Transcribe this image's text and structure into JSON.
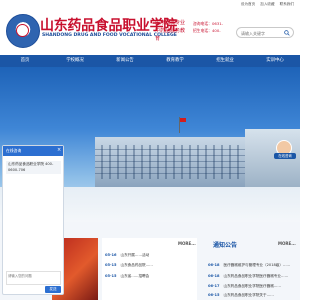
{
  "toplinks": [
    "设为首页",
    "加入收藏",
    "联系我们"
  ],
  "header": {
    "school_name": "山东药品食品职业学院",
    "school_en": "SHANDONG DRUG AND FOOD VOCATIONAL COLLEGE",
    "slogan": "医疗器械专业 中药品服务教育",
    "phone_line1": "咨询电话：0631-",
    "phone_line2": "招生电话：400-",
    "search_placeholder": "请输入关键字"
  },
  "nav": [
    "首页",
    "学校概况",
    "新闻公告",
    "教育教学",
    "招生就业",
    "实训中心"
  ],
  "float": {
    "tag": "在线咨询"
  },
  "news": {
    "more": "MORE...",
    "items": [
      {
        "date": "05-16",
        "title": "山东开展……活动"
      },
      {
        "date": "05-15",
        "title": "山东食品药品院……"
      },
      {
        "date": "05-15",
        "title": "山东省……招聘会"
      }
    ]
  },
  "notice": {
    "title": "通知公告",
    "more": "MORE...",
    "items": [
      {
        "date": "06-18",
        "title": "医疗器械维护与管理专业（2018级）……"
      },
      {
        "date": "06-18",
        "title": "山东药品食品职业学院医疗器械专业……"
      },
      {
        "date": "06-17",
        "title": "山东药品食品职业学院医疗器械……"
      },
      {
        "date": "06-15",
        "title": "山东药品食品职业学院关于……"
      }
    ]
  },
  "chat": {
    "title": "在线咨询",
    "close": "×",
    "message": "山东药品食品职业学院 400-0600-706",
    "input_placeholder": "请输入您的问题",
    "send": "发送"
  }
}
